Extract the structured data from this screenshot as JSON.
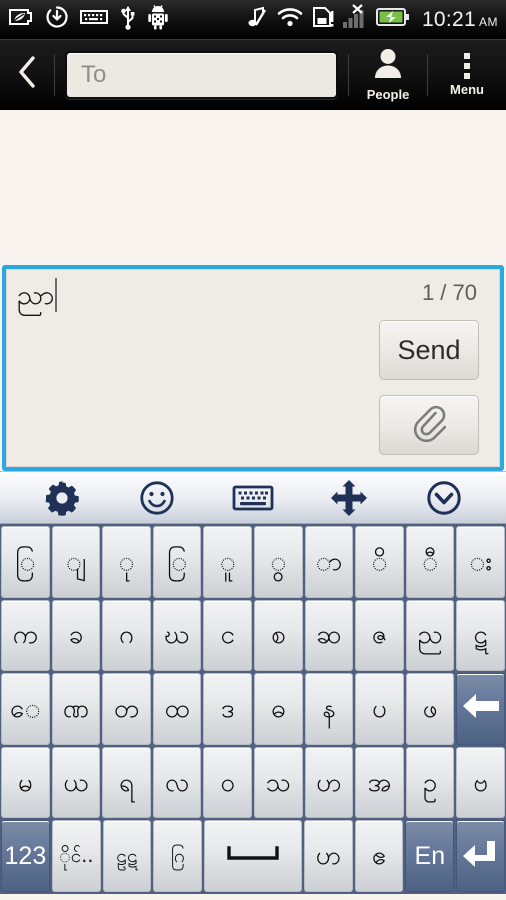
{
  "statusbar": {
    "icons_left": [
      "battery-leaf-icon",
      "download-sync-icon",
      "keyboard-icon",
      "usb-icon",
      "android-robot-icon"
    ],
    "icons_right": [
      "music-mute-icon",
      "wifi-icon",
      "sim-card-alert-icon",
      "signal-no-service-icon",
      "battery-charging-icon"
    ],
    "time": "10:21",
    "ampm": "AM"
  },
  "actionbar": {
    "back_icon": "back-chevron-icon",
    "recipient_placeholder": "To",
    "recipient_value": "",
    "people_label": "People",
    "people_icon": "person-icon",
    "menu_label": "Menu",
    "menu_icon": "overflow-menu-icon"
  },
  "compose": {
    "message_text": "ညာ",
    "char_counter": "1 / 70",
    "send_label": "Send",
    "attach_icon": "paperclip-icon",
    "border_color": "#29a9e0",
    "background_color": "#efebe5"
  },
  "keyboard_toolbar": {
    "items": [
      {
        "name": "settings-gear-icon",
        "label": "Settings"
      },
      {
        "name": "emoji-smiley-icon",
        "label": "Emoji"
      },
      {
        "name": "keyboard-layout-icon",
        "label": "Keyboard"
      },
      {
        "name": "move-arrows-icon",
        "label": "Move"
      },
      {
        "name": "hide-keyboard-chevron-icon",
        "label": "Hide"
      }
    ]
  },
  "keyboard": {
    "key_face_color": "#e6e8ea",
    "key_function_color": "#64779a",
    "frame_color": "#4f6080",
    "rows": [
      {
        "name": "row-diacritics",
        "keys": [
          {
            "label": "ြ",
            "name": "key-ya-yit"
          },
          {
            "label": "ျ",
            "name": "key-ya-pin"
          },
          {
            "label": "ု",
            "name": "key-u"
          },
          {
            "label": "ြ",
            "name": "key-medial-ra"
          },
          {
            "label": "ူ",
            "name": "key-uu"
          },
          {
            "label": "ွ",
            "name": "key-wa-hswe"
          },
          {
            "label": "ာ",
            "name": "key-aa"
          },
          {
            "label": "ိ",
            "name": "key-i"
          },
          {
            "label": "ီ",
            "name": "key-ii"
          },
          {
            "label": "း",
            "name": "key-visarga"
          }
        ]
      },
      {
        "name": "row-consonants-1",
        "keys": [
          {
            "label": "က",
            "name": "key-ka"
          },
          {
            "label": "ခ",
            "name": "key-kha"
          },
          {
            "label": "ဂ",
            "name": "key-ga"
          },
          {
            "label": "ဃ",
            "name": "key-gha"
          },
          {
            "label": "င",
            "name": "key-nga"
          },
          {
            "label": "စ",
            "name": "key-ca"
          },
          {
            "label": "ဆ",
            "name": "key-cha"
          },
          {
            "label": "ဇ",
            "name": "key-ja"
          },
          {
            "label": "ည",
            "name": "key-nya"
          },
          {
            "label": "ဋ",
            "name": "key-tta"
          }
        ]
      },
      {
        "name": "row-consonants-2",
        "keys": [
          {
            "label": "ေ",
            "name": "key-e"
          },
          {
            "label": "ဏ",
            "name": "key-nna"
          },
          {
            "label": "တ",
            "name": "key-ta"
          },
          {
            "label": "ထ",
            "name": "key-tha"
          },
          {
            "label": "ဒ",
            "name": "key-da"
          },
          {
            "label": "ဓ",
            "name": "key-dha"
          },
          {
            "label": "န",
            "name": "key-na"
          },
          {
            "label": "ပ",
            "name": "key-pa"
          },
          {
            "label": "ဖ",
            "name": "key-pha"
          },
          {
            "label": "",
            "name": "key-backspace",
            "icon": "backspace-arrow-icon",
            "fn": true
          }
        ]
      },
      {
        "name": "row-consonants-3",
        "keys": [
          {
            "label": "မ",
            "name": "key-ma"
          },
          {
            "label": "ယ",
            "name": "key-ya"
          },
          {
            "label": "ရ",
            "name": "key-ra"
          },
          {
            "label": "လ",
            "name": "key-la"
          },
          {
            "label": "ဝ",
            "name": "key-wa"
          },
          {
            "label": "သ",
            "name": "key-sa"
          },
          {
            "label": "ဟ",
            "name": "key-ha"
          },
          {
            "label": "အ",
            "name": "key-a"
          },
          {
            "label": "ဥ",
            "name": "key-u-vowel"
          },
          {
            "label": "ဗ",
            "name": "key-ba"
          }
        ]
      },
      {
        "name": "row-bottom",
        "keys": [
          {
            "label": "123",
            "name": "key-numbers",
            "fn": true
          },
          {
            "label": "ိုင်..",
            "name": "key-symbols-burmese",
            "small": true
          },
          {
            "label": "ဠဋ",
            "name": "key-extra-consonants",
            "small": true
          },
          {
            "label": "ဂြ",
            "name": "key-stacked-consonants",
            "small": true
          },
          {
            "label": "",
            "name": "key-space",
            "icon": "space-bar-icon",
            "space": true
          },
          {
            "label": "ဟ",
            "name": "key-ha-alt"
          },
          {
            "label": "ဧ",
            "name": "key-e-vowel"
          },
          {
            "label": "En",
            "name": "key-language-english",
            "fn": true
          },
          {
            "label": "",
            "name": "key-enter",
            "icon": "enter-return-icon",
            "fn": true
          }
        ]
      }
    ]
  }
}
